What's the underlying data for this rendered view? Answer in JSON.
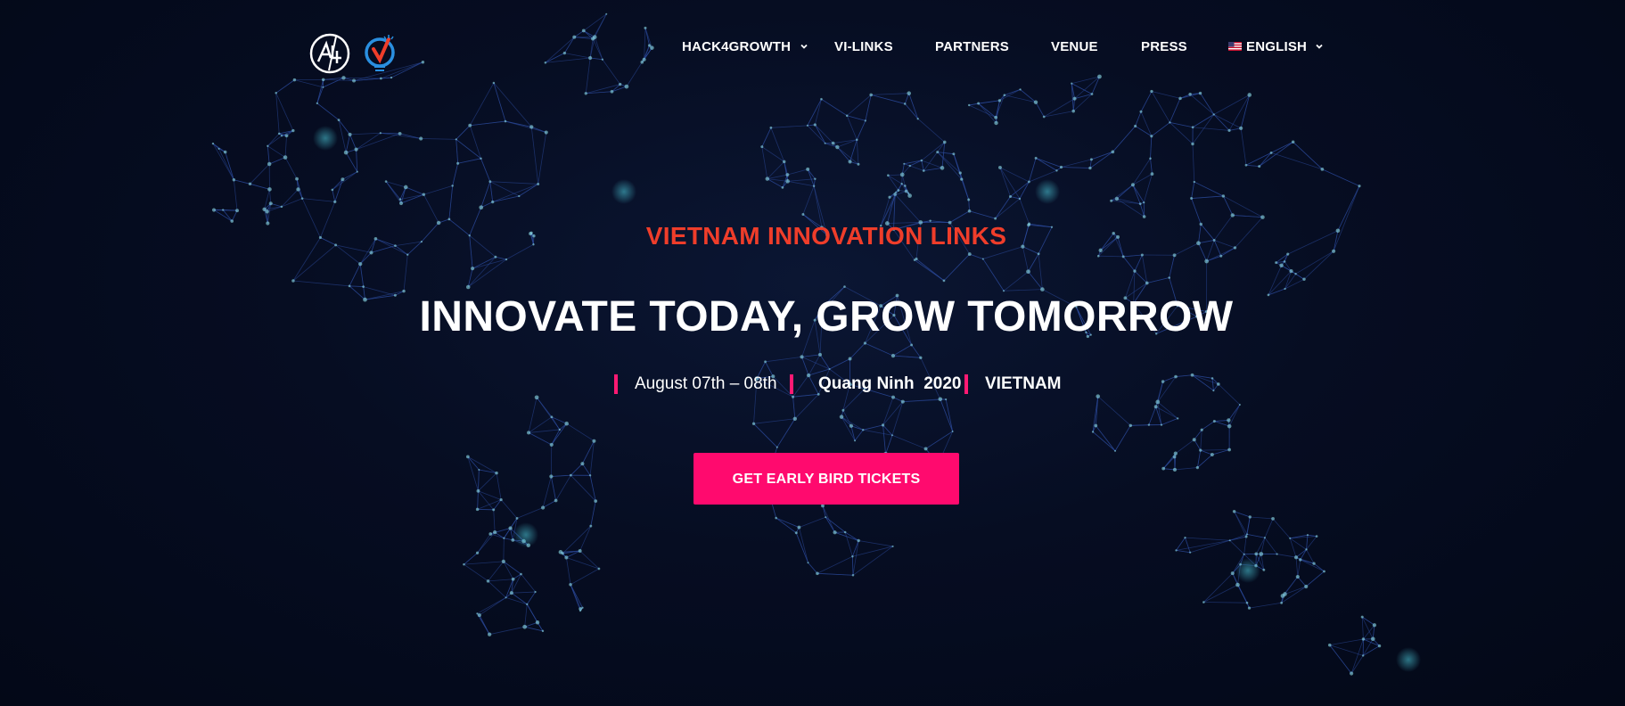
{
  "nav": {
    "items": [
      {
        "label": "HACK4GROWTH",
        "has_dropdown": true
      },
      {
        "label": "VI-LINKS",
        "has_dropdown": false
      },
      {
        "label": "PARTNERS",
        "has_dropdown": false
      },
      {
        "label": "VENUE",
        "has_dropdown": false
      },
      {
        "label": "PRESS",
        "has_dropdown": false
      }
    ],
    "language": {
      "label": "ENGLISH",
      "flag_icon": "us-flag-icon",
      "has_dropdown": true
    }
  },
  "hero": {
    "eyebrow": "VIETNAM INNOVATION LINKS",
    "headline": "INNOVATE TODAY, GROW TOMORROW",
    "date": "August 07th – 08th",
    "location": "Quang Ninh  2020",
    "country": "VIETNAM",
    "cta_label": "GET EARLY BIRD TICKETS"
  },
  "colors": {
    "background": "#040a1c",
    "accent_red": "#ef3d2a",
    "accent_pink": "#ff0a6e",
    "network_line": "#2a4a9a",
    "network_node": "#7fd8e6"
  },
  "icons": [
    "hack4growth-logo-icon",
    "vi-links-logo-icon",
    "chevron-down-icon",
    "us-flag-icon",
    "world-network-map"
  ]
}
